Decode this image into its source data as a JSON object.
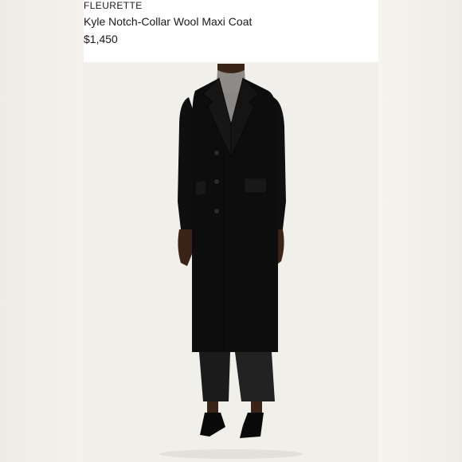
{
  "product": {
    "brand": "FLEURETTE",
    "name": "Kyle Notch-Collar Wool Maxi Coat",
    "price": "$1,450"
  },
  "colors": {
    "background": "#f3f0eb",
    "card": "#ffffff",
    "photo_background": "#f1efea",
    "coat": "#0d0d0d",
    "text": "#1a1a1a"
  }
}
